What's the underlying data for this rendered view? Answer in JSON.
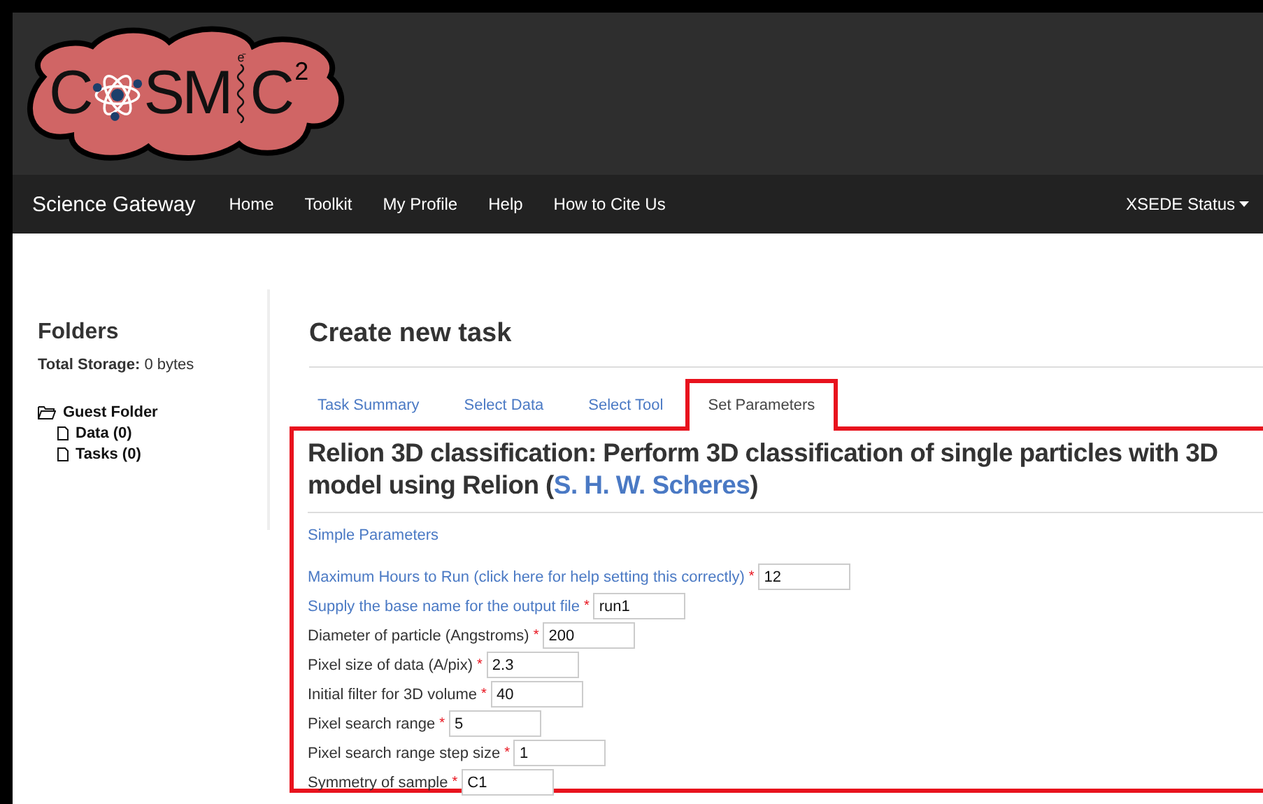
{
  "logo": {
    "letters_before": "C",
    "letters_middle": "SM",
    "letters_after": "C",
    "superscript": "2",
    "electron": "e⁻"
  },
  "navbar": {
    "brand": "Science Gateway",
    "items": [
      "Home",
      "Toolkit",
      "My Profile",
      "Help",
      "How to Cite Us"
    ],
    "right_menu": "XSEDE Status"
  },
  "sidebar": {
    "title": "Folders",
    "storage_label": "Total Storage:",
    "storage_value": "0 bytes",
    "folder": {
      "name": "Guest Folder",
      "children": [
        {
          "name": "Data (0)"
        },
        {
          "name": "Tasks (0)"
        }
      ]
    }
  },
  "main": {
    "title": "Create new task",
    "tabs": [
      {
        "label": "Task Summary",
        "selected": false
      },
      {
        "label": "Select Data",
        "selected": false
      },
      {
        "label": "Select Tool",
        "selected": false
      },
      {
        "label": "Set Parameters",
        "selected": true
      }
    ],
    "heading": {
      "text_before": "Relion 3D classification: Perform 3D classification of single particles with 3D model using Relion (",
      "link": "S. H. W. Scheres",
      "text_after": ")"
    },
    "section_link": "Simple Parameters",
    "parameters": [
      {
        "kind": "link",
        "label": "Maximum Hours to Run (click here for help setting this correctly)",
        "required_mark": "*",
        "value": "12"
      },
      {
        "kind": "link",
        "label": "Supply the base name for the output file",
        "required_mark": "*",
        "value": "run1"
      },
      {
        "kind": "plain",
        "label": "Diameter of particle (Angstroms)",
        "required_mark": "*",
        "value": "200"
      },
      {
        "kind": "plain",
        "label": "Pixel size of data (A/pix)",
        "required_mark": "*",
        "value": "2.3"
      },
      {
        "kind": "plain",
        "label": "Initial filter for 3D volume",
        "required_mark": "*",
        "value": "40"
      },
      {
        "kind": "plain",
        "label": "Pixel search range",
        "required_mark": "*",
        "value": "5"
      },
      {
        "kind": "plain",
        "label": "Pixel search range step size",
        "required_mark": "*",
        "value": "1"
      },
      {
        "kind": "plain",
        "label": "Symmetry of sample",
        "required_mark": "*",
        "value": "C1"
      }
    ]
  }
}
